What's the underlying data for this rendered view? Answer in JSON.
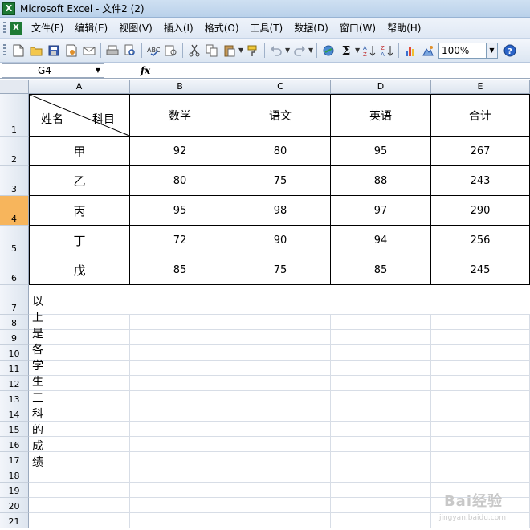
{
  "window": {
    "title": "Microsoft Excel - 文件2 (2)",
    "app_icon": "excel-icon"
  },
  "menu": {
    "items": [
      "文件(F)",
      "编辑(E)",
      "视图(V)",
      "插入(I)",
      "格式(O)",
      "工具(T)",
      "数据(D)",
      "窗口(W)",
      "帮助(H)"
    ]
  },
  "toolbar": {
    "zoom": "100%"
  },
  "formula_bar": {
    "name_box": "G4",
    "fx": "fx",
    "content": ""
  },
  "columns": [
    "A",
    "B",
    "C",
    "D",
    "E"
  ],
  "rows": [
    "1",
    "2",
    "3",
    "4",
    "5",
    "6",
    "7",
    "8",
    "9",
    "10",
    "11",
    "12",
    "13",
    "14",
    "15",
    "16",
    "17",
    "18",
    "19",
    "20",
    "21"
  ],
  "active_row": "4",
  "table": {
    "header_diag_left": "姓名",
    "header_diag_right": "科目",
    "headers": [
      "数学",
      "语文",
      "英语",
      "合计"
    ],
    "rows": [
      {
        "name": "甲",
        "values": [
          "92",
          "80",
          "95",
          "267"
        ]
      },
      {
        "name": "乙",
        "values": [
          "80",
          "75",
          "88",
          "243"
        ]
      },
      {
        "name": "丙",
        "values": [
          "95",
          "98",
          "97",
          "290"
        ]
      },
      {
        "name": "丁",
        "values": [
          "72",
          "90",
          "94",
          "256"
        ]
      },
      {
        "name": "戊",
        "values": [
          "85",
          "75",
          "85",
          "245"
        ]
      }
    ],
    "note": "以上是各学生三科的成绩"
  },
  "watermark": {
    "text": "Bai经验",
    "sub": "jingyan.baidu.com"
  },
  "colors": {
    "active_row": "#f7b55c",
    "title_bar": "#cfe0f2",
    "grid_line": "#d7dde6"
  }
}
